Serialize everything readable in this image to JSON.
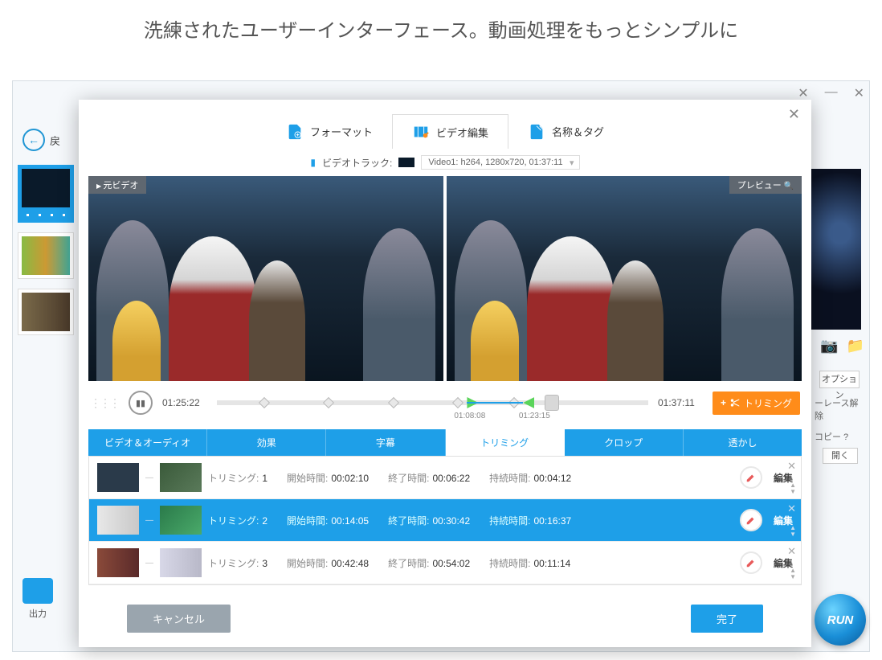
{
  "headline": "洗練されたユーザーインターフェース。動画処理をもっとシンプルに",
  "win": {
    "min": "—",
    "close": "✕"
  },
  "back": "戻",
  "topTabs": {
    "format": "フォーマット",
    "edit": "ビデオ編集",
    "name": "名称＆タグ"
  },
  "trackLabel": "ビデオトラック:",
  "trackValue": "Video1: h264, 1280x720, 01:37:11",
  "badges": {
    "src": "元ビデオ",
    "preview": "プレビュー"
  },
  "timeline": {
    "cur": "01:25:22",
    "end": "01:37:11",
    "markA": "01:08:08",
    "markB": "01:23:15"
  },
  "trimBtn": "トリミング",
  "etabs": [
    "ビデオ＆オーディオ",
    "効果",
    "字幕",
    "トリミング",
    "クロップ",
    "透かし"
  ],
  "etabActive": 3,
  "labels": {
    "trim": "トリミング:",
    "start": "開始時間:",
    "end": "終了時間:",
    "dur": "持続時間:",
    "edit": "編集"
  },
  "clips": [
    {
      "n": "1",
      "s": "00:02:10",
      "e": "00:06:22",
      "d": "00:04:12"
    },
    {
      "n": "2",
      "s": "00:14:05",
      "e": "00:30:42",
      "d": "00:16:37"
    },
    {
      "n": "3",
      "s": "00:42:48",
      "e": "00:54:02",
      "d": "00:11:14"
    }
  ],
  "selClip": 1,
  "footer": {
    "cancel": "キャンセル",
    "ok": "完了"
  },
  "side": {
    "opt": "オプション",
    "deint": "ーレース解除",
    "copy": "コピー ?",
    "open": "開く"
  },
  "output": "出力",
  "run": "RUN"
}
